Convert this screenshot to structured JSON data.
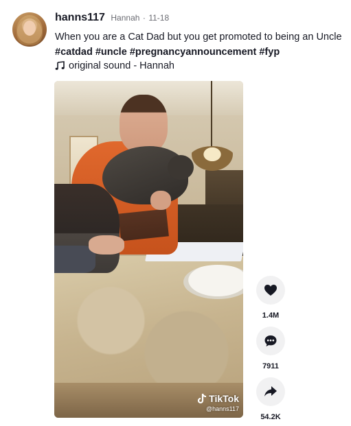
{
  "post": {
    "username": "hanns117",
    "nickname": "Hannah",
    "separator": "·",
    "date": "11-18",
    "caption": "When you are a Cat Dad but you get promoted to being an Uncle",
    "hashtags": [
      "#catdad",
      "#uncle",
      "#pregnancyannouncement",
      "#fyp"
    ],
    "music": "original sound - Hannah",
    "music_icon": "music-note-icon"
  },
  "video": {
    "watermark_brand": "TikTok",
    "watermark_handle": "@hanns117"
  },
  "actions": {
    "likes": {
      "icon": "heart-icon",
      "count": "1.4M"
    },
    "comments": {
      "icon": "comment-icon",
      "count": "7911"
    },
    "shares": {
      "icon": "share-icon",
      "count": "54.2K"
    }
  },
  "colors": {
    "text": "#161823",
    "muted": "#6a6b72",
    "action_bg": "#f1f1f2"
  }
}
